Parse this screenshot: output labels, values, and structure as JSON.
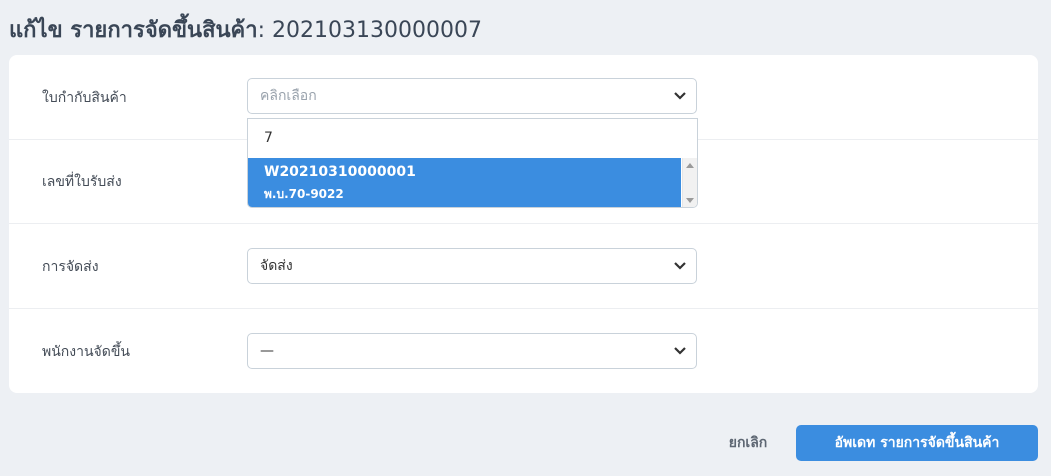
{
  "header": {
    "title_prefix": "แก้ไข รายการจัดขึ้นสินค้า",
    "title_number": ": 202103130000007"
  },
  "form": {
    "fields": [
      {
        "label": "ใบกำกับสินค้า",
        "value": "คลิกเลือก"
      },
      {
        "label": "เลขที่ใบรับส่ง",
        "value": ""
      },
      {
        "label": "การจัดส่ง",
        "value": "จัดส่ง"
      },
      {
        "label": "พนักงานจัดขึ้น",
        "value": "—"
      }
    ],
    "dropdown": {
      "search_value": "7",
      "options": [
        {
          "code": "W20210310000001",
          "sub": "พ.บ.70-9022"
        }
      ]
    }
  },
  "footer": {
    "cancel_label": "ยกเลิก",
    "submit_label": "อัพเดท รายการจัดขึ้นสินค้า"
  },
  "colors": {
    "accent": "#3b8de0",
    "background": "#edf0f4"
  }
}
